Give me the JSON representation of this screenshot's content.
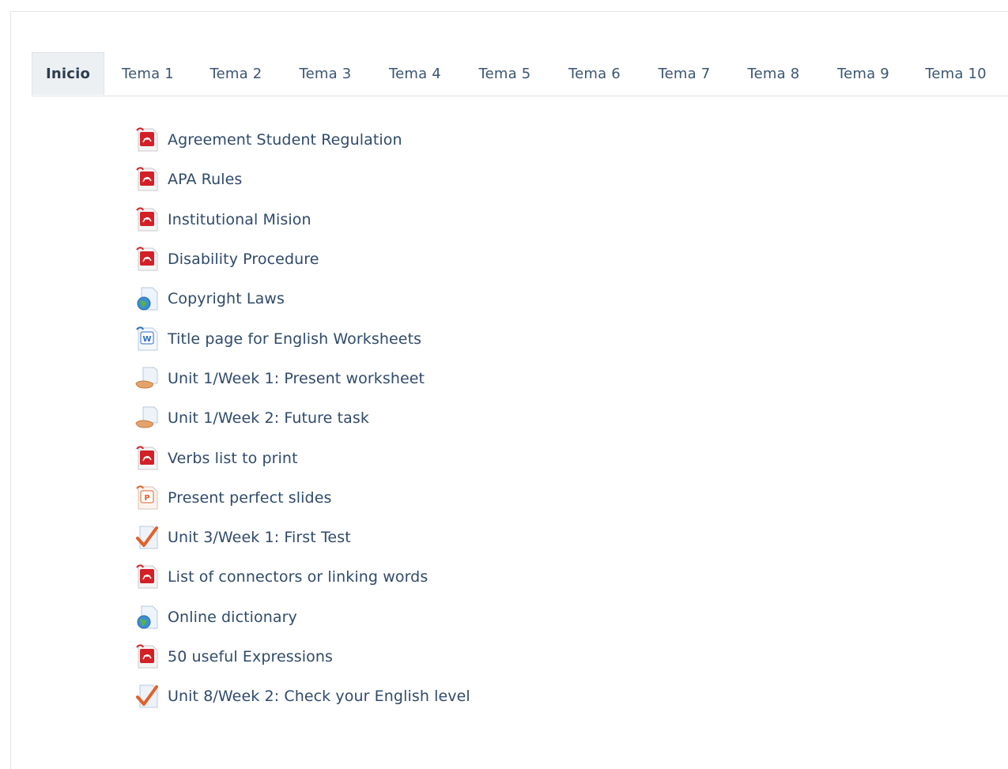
{
  "tabs": [
    {
      "label": "Inicio",
      "active": true
    },
    {
      "label": "Tema 1"
    },
    {
      "label": "Tema 2"
    },
    {
      "label": "Tema 3"
    },
    {
      "label": "Tema 4"
    },
    {
      "label": "Tema 5"
    },
    {
      "label": "Tema 6"
    },
    {
      "label": "Tema 7"
    },
    {
      "label": "Tema 8"
    },
    {
      "label": "Tema 9"
    },
    {
      "label": "Tema 10"
    }
  ],
  "activities": [
    {
      "label": "Agreement Student Regulation",
      "icon": "pdf-icon"
    },
    {
      "label": "APA Rules",
      "icon": "pdf-icon"
    },
    {
      "label": "Institutional Mision",
      "icon": "pdf-icon"
    },
    {
      "label": "Disability Procedure",
      "icon": "pdf-icon"
    },
    {
      "label": "Copyright Laws",
      "icon": "url-globe-icon"
    },
    {
      "label": "Title page for English Worksheets",
      "icon": "word-document-icon"
    },
    {
      "label": "Unit 1/Week 1: Present worksheet",
      "icon": "assignment-icon"
    },
    {
      "label": "Unit 1/Week 2: Future task",
      "icon": "assignment-icon"
    },
    {
      "label": "Verbs list to print",
      "icon": "pdf-icon"
    },
    {
      "label": "Present perfect slides",
      "icon": "powerpoint-icon"
    },
    {
      "label": "Unit 3/Week 1: First Test",
      "icon": "quiz-checkmark-icon"
    },
    {
      "label": "List of connectors or linking words",
      "icon": "pdf-icon"
    },
    {
      "label": "Online dictionary",
      "icon": "url-globe-icon"
    },
    {
      "label": "50 useful Expressions",
      "icon": "pdf-icon"
    },
    {
      "label": "Unit 8/Week 2: Check your English level",
      "icon": "quiz-checkmark-icon"
    }
  ],
  "colors": {
    "link": "#2f4a6b",
    "active_tab_bg": "#edf0f3",
    "pdf_red": "#d32027",
    "word_blue": "#2b6cc4",
    "quiz_orange": "#e0622a"
  }
}
